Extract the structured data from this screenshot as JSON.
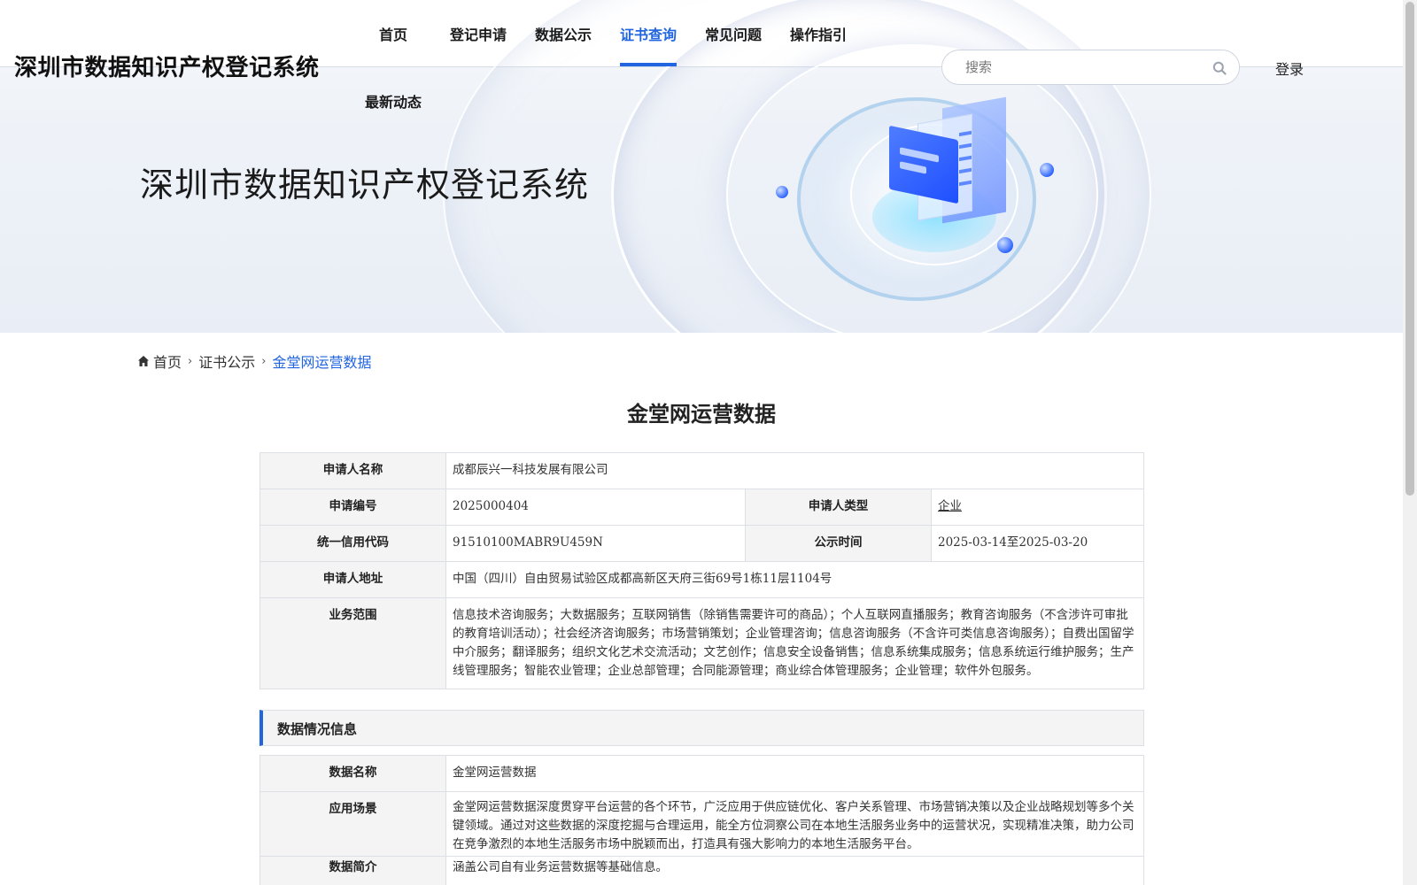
{
  "header": {
    "site_title": "深圳市数据知识产权登记系统",
    "nav": [
      {
        "label": "首页"
      },
      {
        "label": "登记申请"
      },
      {
        "label": "数据公示"
      },
      {
        "label": "证书查询"
      },
      {
        "label": "常见问题"
      },
      {
        "label": "操作指引"
      },
      {
        "label": "最新动态"
      }
    ],
    "active_nav": "证书查询",
    "search_placeholder": "搜索",
    "login_label": "登录"
  },
  "hero": {
    "title": "深圳市数据知识产权登记系统"
  },
  "breadcrumb": {
    "home": "首页",
    "level2": "证书公示",
    "current": "金堂网运营数据"
  },
  "page_title": "金堂网运营数据",
  "applicant": {
    "name_label": "申请人名称",
    "name_value": "成都辰兴一科技发展有限公司",
    "code_label": "申请编号",
    "code_value": "2025000404",
    "type_label": "申请人类型",
    "type_value": "企业",
    "credit_label": "统一信用代码",
    "credit_value": "91510100MABR9U459N",
    "pub_label": "公示时间",
    "pub_value": "2025-03-14至2025-03-20",
    "addr_label": "申请人地址",
    "addr_value": "中国（四川）自由贸易试验区成都高新区天府三街69号1栋11层1104号",
    "scope_label": "业务范围",
    "scope_value": "信息技术咨询服务；大数据服务；互联网销售（除销售需要许可的商品）；个人互联网直播服务；教育咨询服务（不含涉许可审批的教育培训活动）；社会经济咨询服务；市场营销策划；企业管理咨询；信息咨询服务（不含许可类信息咨询服务）；自费出国留学中介服务；翻译服务；组织文化艺术交流活动；文艺创作；信息安全设备销售；信息系统集成服务；信息系统运行维护服务；生产线管理服务；智能农业管理；企业总部管理；合同能源管理；商业综合体管理服务；企业管理；软件外包服务。"
  },
  "data_section": {
    "heading": "数据情况信息",
    "name_label": "数据名称",
    "name_value": "金堂网运营数据",
    "scene_label": "应用场景",
    "scene_value": "金堂网运营数据深度贯穿平台运营的各个环节，广泛应用于供应链优化、客户关系管理、市场营销决策以及企业战略规划等多个关键领域。通过对这些数据的深度挖掘与合理运用，能全方位洞察公司在本地生活服务业务中的运营状况，实现精准决策，助力公司在竞争激烈的本地生活服务市场中脱颖而出，打造具有强大影响力的本地生活服务平台。",
    "intro_label": "数据简介",
    "intro_value": "涵盖公司自有业务运营数据等基础信息。"
  },
  "colors": {
    "accent": "#2165e0",
    "label_bg": "#f4f4f4",
    "border": "#dcdfe4"
  }
}
